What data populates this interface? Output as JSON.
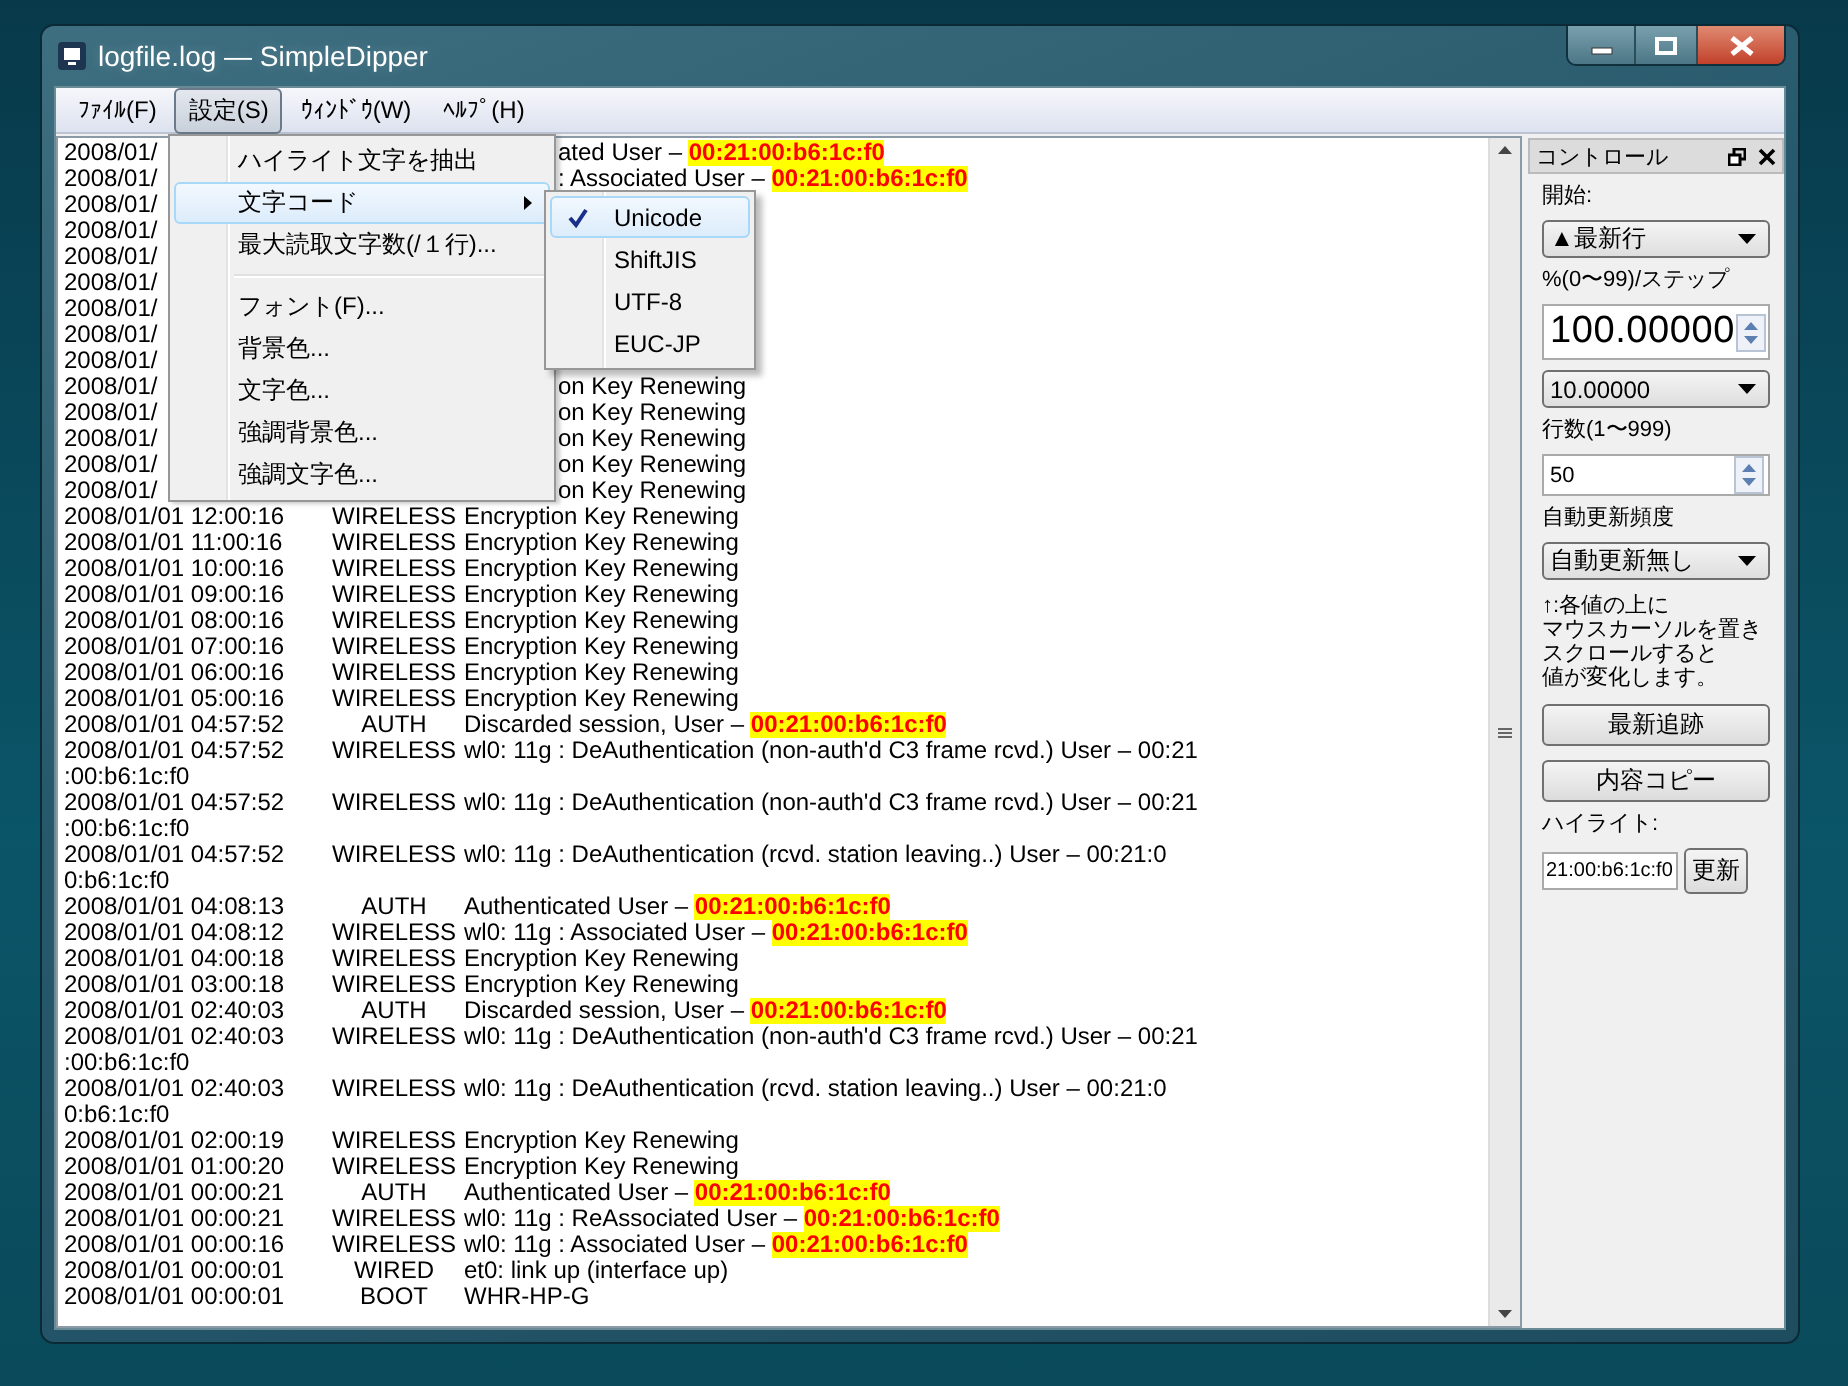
{
  "window": {
    "title": "logfile.log — SimpleDipper"
  },
  "menubar": [
    {
      "label": "ﾌｧｲﾙ(F)",
      "selected": false
    },
    {
      "label": "設定(S)",
      "selected": true
    },
    {
      "label": "ｳｨﾝﾄﾞｳ(W)",
      "selected": false
    },
    {
      "label": "ﾍﾙﾌﾟ(H)",
      "selected": false
    }
  ],
  "menu": [
    {
      "kind": "item",
      "label": "ハイライト文字を抽出",
      "selected": false
    },
    {
      "kind": "submenu",
      "label": "文字コード",
      "selected": true
    },
    {
      "kind": "item",
      "label": "最大読取文字数(/１行)...",
      "selected": false
    },
    {
      "kind": "separator"
    },
    {
      "kind": "item",
      "label": "フォント(F)...",
      "selected": false
    },
    {
      "kind": "item",
      "label": "背景色...",
      "selected": false
    },
    {
      "kind": "item",
      "label": "文字色...",
      "selected": false
    },
    {
      "kind": "item",
      "label": "強調背景色...",
      "selected": false
    },
    {
      "kind": "item",
      "label": "強調文字色...",
      "selected": false
    }
  ],
  "submenu": [
    {
      "label": "Unicode",
      "checked": true,
      "selected": true
    },
    {
      "label": "ShiftJIS",
      "checked": false,
      "selected": false
    },
    {
      "label": "UTF-8",
      "checked": false,
      "selected": false
    },
    {
      "label": "EUC-JP",
      "checked": false,
      "selected": false
    }
  ],
  "log": [
    {
      "kind": "covered",
      "start": "2008/01/",
      "tail": "ated User – ",
      "highlight": "00:21:00:b6:1c:f0"
    },
    {
      "kind": "covered",
      "start": "2008/01/",
      "tail": ": Associated User – ",
      "highlight": "00:21:00:b6:1c:f0"
    },
    {
      "kind": "covered",
      "start": "2008/01/"
    },
    {
      "kind": "covered",
      "start": "2008/01/"
    },
    {
      "kind": "covered",
      "start": "2008/01/"
    },
    {
      "kind": "covered",
      "start": "2008/01/"
    },
    {
      "kind": "covered",
      "start": "2008/01/"
    },
    {
      "kind": "covered",
      "start": "2008/01/"
    },
    {
      "kind": "covered",
      "start": "2008/01/"
    },
    {
      "kind": "covered",
      "start": "2008/01/",
      "tail": "on Key Renewing"
    },
    {
      "kind": "covered",
      "start": "2008/01/",
      "tail": "on Key Renewing"
    },
    {
      "kind": "covered",
      "start": "2008/01/",
      "tail": "on Key Renewing"
    },
    {
      "kind": "covered",
      "start": "2008/01/",
      "tail": "on Key Renewing"
    },
    {
      "kind": "covered",
      "start": "2008/01/",
      "tail": "on Key Renewing"
    },
    {
      "kind": "entry",
      "time": "2008/01/01 12:00:16",
      "source": "WIRELESS",
      "message": "Encryption Key Renewing"
    },
    {
      "kind": "entry",
      "time": "2008/01/01 11:00:16",
      "source": "WIRELESS",
      "message": "Encryption Key Renewing"
    },
    {
      "kind": "entry",
      "time": "2008/01/01 10:00:16",
      "source": "WIRELESS",
      "message": "Encryption Key Renewing"
    },
    {
      "kind": "entry",
      "time": "2008/01/01 09:00:16",
      "source": "WIRELESS",
      "message": "Encryption Key Renewing"
    },
    {
      "kind": "entry",
      "time": "2008/01/01 08:00:16",
      "source": "WIRELESS",
      "message": "Encryption Key Renewing"
    },
    {
      "kind": "entry",
      "time": "2008/01/01 07:00:16",
      "source": "WIRELESS",
      "message": "Encryption Key Renewing"
    },
    {
      "kind": "entry",
      "time": "2008/01/01 06:00:16",
      "source": "WIRELESS",
      "message": "Encryption Key Renewing"
    },
    {
      "kind": "entry",
      "time": "2008/01/01 05:00:16",
      "source": "WIRELESS",
      "message": "Encryption Key Renewing"
    },
    {
      "kind": "entry",
      "time": "2008/01/01 04:57:52",
      "source": "AUTH",
      "message": "Discarded session, User – ",
      "highlight": "00:21:00:b6:1c:f0"
    },
    {
      "kind": "entry",
      "time": "2008/01/01 04:57:52",
      "source": "WIRELESS",
      "message": "wl0: 11g : DeAuthentication (non-auth'd C3 frame rcvd.) User – 00:21"
    },
    {
      "kind": "continuation",
      "text": ":00:b6:1c:f0"
    },
    {
      "kind": "entry",
      "time": "2008/01/01 04:57:52",
      "source": "WIRELESS",
      "message": "wl0: 11g : DeAuthentication (non-auth'd C3 frame rcvd.) User – 00:21"
    },
    {
      "kind": "continuation",
      "text": ":00:b6:1c:f0"
    },
    {
      "kind": "entry",
      "time": "2008/01/01 04:57:52",
      "source": "WIRELESS",
      "message": "wl0: 11g : DeAuthentication (rcvd. station leaving..) User – 00:21:0"
    },
    {
      "kind": "continuation",
      "text": "0:b6:1c:f0"
    },
    {
      "kind": "entry",
      "time": "2008/01/01 04:08:13",
      "source": "AUTH",
      "message": "Authenticated User – ",
      "highlight": "00:21:00:b6:1c:f0"
    },
    {
      "kind": "entry",
      "time": "2008/01/01 04:08:12",
      "source": "WIRELESS",
      "message": "wl0: 11g : Associated User – ",
      "highlight": "00:21:00:b6:1c:f0"
    },
    {
      "kind": "entry",
      "time": "2008/01/01 04:00:18",
      "source": "WIRELESS",
      "message": "Encryption Key Renewing"
    },
    {
      "kind": "entry",
      "time": "2008/01/01 03:00:18",
      "source": "WIRELESS",
      "message": "Encryption Key Renewing"
    },
    {
      "kind": "entry",
      "time": "2008/01/01 02:40:03",
      "source": "AUTH",
      "message": "Discarded session, User – ",
      "highlight": "00:21:00:b6:1c:f0"
    },
    {
      "kind": "entry",
      "time": "2008/01/01 02:40:03",
      "source": "WIRELESS",
      "message": "wl0: 11g : DeAuthentication (non-auth'd C3 frame rcvd.) User – 00:21"
    },
    {
      "kind": "continuation",
      "text": ":00:b6:1c:f0"
    },
    {
      "kind": "entry",
      "time": "2008/01/01 02:40:03",
      "source": "WIRELESS",
      "message": "wl0: 11g : DeAuthentication (rcvd. station leaving..) User – 00:21:0"
    },
    {
      "kind": "continuation",
      "text": "0:b6:1c:f0"
    },
    {
      "kind": "entry",
      "time": "2008/01/01 02:00:19",
      "source": "WIRELESS",
      "message": "Encryption Key Renewing"
    },
    {
      "kind": "entry",
      "time": "2008/01/01 01:00:20",
      "source": "WIRELESS",
      "message": "Encryption Key Renewing"
    },
    {
      "kind": "entry",
      "time": "2008/01/01 00:00:21",
      "source": "AUTH",
      "message": "Authenticated User – ",
      "highlight": "00:21:00:b6:1c:f0"
    },
    {
      "kind": "entry",
      "time": "2008/01/01 00:00:21",
      "source": "WIRELESS",
      "message": "wl0: 11g : ReAssociated User – ",
      "highlight": "00:21:00:b6:1c:f0"
    },
    {
      "kind": "entry",
      "time": "2008/01/01 00:00:16",
      "source": "WIRELESS",
      "message": "wl0: 11g : Associated User – ",
      "highlight": "00:21:00:b6:1c:f0"
    },
    {
      "kind": "entry",
      "time": "2008/01/01 00:00:01",
      "source": "WIRED",
      "message": "et0: link up (interface up)"
    },
    {
      "kind": "entry",
      "time": "2008/01/01 00:00:01",
      "source": "BOOT",
      "message": "WHR-HP-G"
    }
  ],
  "panel": {
    "title": "コントロール",
    "controls": [
      {
        "kind": "label",
        "text": "開始:"
      },
      {
        "kind": "dropdown",
        "value": "▲最新行"
      },
      {
        "kind": "label",
        "text": "%(0〜99)/ステップ"
      },
      {
        "kind": "spinbox",
        "value": "100.00000",
        "large": true
      },
      {
        "kind": "dropdown",
        "value": "10.00000"
      },
      {
        "kind": "label",
        "text": "行数(1〜999)"
      },
      {
        "kind": "spinbox",
        "value": "50",
        "large": false
      },
      {
        "kind": "label",
        "text": "自動更新頻度"
      },
      {
        "kind": "dropdown",
        "value": "自動更新無し"
      },
      {
        "kind": "note",
        "lines": [
          "↑:各値の上に",
          "マウスカーソルを置き",
          "スクロールすると",
          "値が変化します。"
        ]
      },
      {
        "kind": "button",
        "label": "最新追跡"
      },
      {
        "kind": "button",
        "label": "内容コピー"
      },
      {
        "kind": "label",
        "text": "ハイライト:"
      },
      {
        "kind": "field_button",
        "value": "21:00:b6:1c:f0",
        "button": "更新"
      }
    ]
  }
}
